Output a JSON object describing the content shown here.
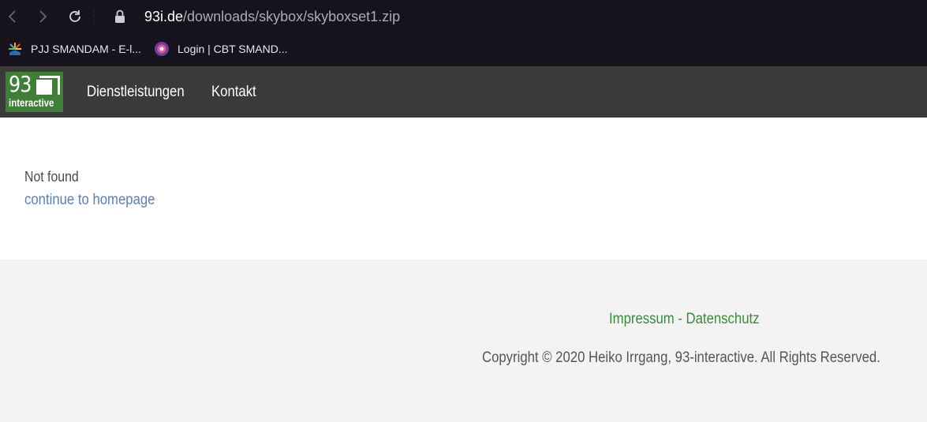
{
  "browser": {
    "url_host": "93i.de",
    "url_path": "/downloads/skybox/skyboxset1.zip",
    "bookmarks": [
      {
        "label": "PJJ SMANDAM - E-l...",
        "icon": "sunburst-icon"
      },
      {
        "label": "Login | CBT SMAND...",
        "icon": "lollipop-icon"
      }
    ]
  },
  "site": {
    "logo": {
      "number": "93",
      "word": "interactive"
    },
    "menu": [
      {
        "label": "Dienstleistungen"
      },
      {
        "label": "Kontakt"
      }
    ]
  },
  "main": {
    "message": "Not found",
    "home_link": "continue to homepage"
  },
  "footer": {
    "impressum": "Impressum",
    "separator": " - ",
    "datenschutz": "Datenschutz",
    "copyright": "Copyright © 2020 Heiko Irrgang, 93-interactive. All Rights Reserved."
  },
  "colors": {
    "chrome_bg": "#17131d",
    "header_bg": "#3a3a3a",
    "logo_green": "#3f7f37",
    "link_blue": "#5b7eb5",
    "footer_link_green": "#3a8a3a",
    "footer_bg": "#f3f3f3"
  }
}
